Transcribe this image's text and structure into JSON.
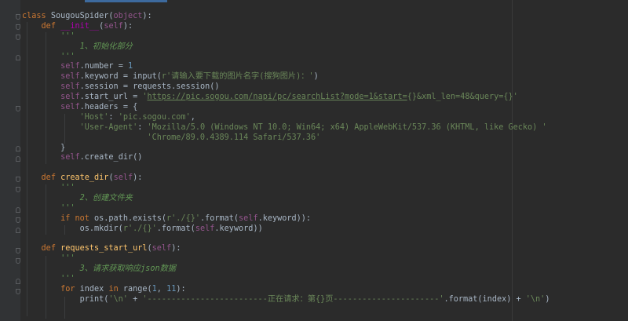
{
  "editor": {
    "lines": [
      [
        [
          "kw",
          "class "
        ],
        [
          "p",
          "SougouSpider("
        ],
        [
          "self",
          "object"
        ],
        [
          "p",
          "):"
        ]
      ],
      [
        [
          "p",
          "    "
        ],
        [
          "kw",
          "def "
        ],
        [
          "dunder",
          "__init__"
        ],
        [
          "p",
          "("
        ],
        [
          "self",
          "self"
        ],
        [
          "p",
          "):"
        ]
      ],
      [
        [
          "doc",
          "        '''"
        ]
      ],
      [
        [
          "doc",
          "            1、初始化部分"
        ]
      ],
      [
        [
          "doc",
          "        '''"
        ]
      ],
      [
        [
          "p",
          "        "
        ],
        [
          "self",
          "self"
        ],
        [
          "p",
          ".number = "
        ],
        [
          "num",
          "1"
        ]
      ],
      [
        [
          "p",
          "        "
        ],
        [
          "self",
          "self"
        ],
        [
          "p",
          ".keyword = input("
        ],
        [
          "str",
          "r'请输入要下载的图片名字(搜狗图片)：'"
        ],
        [
          "p",
          ")"
        ]
      ],
      [
        [
          "p",
          "        "
        ],
        [
          "self",
          "self"
        ],
        [
          "p",
          ".session = requests.session()"
        ]
      ],
      [
        [
          "p",
          "        "
        ],
        [
          "self",
          "self"
        ],
        [
          "p",
          ".start_url = "
        ],
        [
          "str",
          "'"
        ],
        [
          "url",
          "https://pic.sogou.com/napi/pc/searchList?mode=1&start="
        ],
        [
          "str",
          "{}&xml_len=48&query={}'"
        ]
      ],
      [
        [
          "p",
          "        "
        ],
        [
          "self",
          "self"
        ],
        [
          "p",
          ".headers = {"
        ]
      ],
      [
        [
          "p",
          "            "
        ],
        [
          "str",
          "'Host'"
        ],
        [
          "p",
          ": "
        ],
        [
          "str",
          "'pic.sogou.com'"
        ],
        [
          "p",
          ","
        ]
      ],
      [
        [
          "p",
          "            "
        ],
        [
          "str",
          "'User-Agent'"
        ],
        [
          "p",
          ": "
        ],
        [
          "str",
          "'Mozilla/5.0 (Windows NT 10.0; Win64; x64) AppleWebKit/537.36 (KHTML, like Gecko) '"
        ]
      ],
      [
        [
          "p",
          "                          "
        ],
        [
          "str",
          "'Chrome/89.0.4389.114 Safari/537.36'"
        ]
      ],
      [
        [
          "p",
          "        }"
        ]
      ],
      [
        [
          "p",
          "        "
        ],
        [
          "self",
          "self"
        ],
        [
          "p",
          ".create_dir()"
        ]
      ],
      [],
      [
        [
          "p",
          "    "
        ],
        [
          "kw",
          "def "
        ],
        [
          "fn",
          "create_dir"
        ],
        [
          "p",
          "("
        ],
        [
          "self",
          "self"
        ],
        [
          "p",
          "):"
        ]
      ],
      [
        [
          "doc",
          "        '''"
        ]
      ],
      [
        [
          "doc",
          "            2、创建文件夹"
        ]
      ],
      [
        [
          "doc",
          "        '''"
        ]
      ],
      [
        [
          "p",
          "        "
        ],
        [
          "kw",
          "if not "
        ],
        [
          "p",
          "os.path.exists("
        ],
        [
          "str",
          "r'./{}'"
        ],
        [
          "p",
          ".format("
        ],
        [
          "self",
          "self"
        ],
        [
          "p",
          ".keyword)):"
        ]
      ],
      [
        [
          "p",
          "            os.mkdir("
        ],
        [
          "str",
          "r'./{}'"
        ],
        [
          "p",
          ".format("
        ],
        [
          "self",
          "self"
        ],
        [
          "p",
          ".keyword))"
        ]
      ],
      [],
      [
        [
          "p",
          "    "
        ],
        [
          "kw",
          "def "
        ],
        [
          "fn",
          "requests_start_url"
        ],
        [
          "p",
          "("
        ],
        [
          "self",
          "self"
        ],
        [
          "p",
          "):"
        ]
      ],
      [
        [
          "doc",
          "        '''"
        ]
      ],
      [
        [
          "doc",
          "            3、请求获取响应json数据"
        ]
      ],
      [
        [
          "doc",
          "        '''"
        ]
      ],
      [
        [
          "p",
          "        "
        ],
        [
          "kw",
          "for "
        ],
        [
          "p",
          "index "
        ],
        [
          "kw",
          "in "
        ],
        [
          "p",
          "range("
        ],
        [
          "num",
          "1"
        ],
        [
          "p",
          ", "
        ],
        [
          "num",
          "11"
        ],
        [
          "p",
          "):"
        ]
      ],
      [
        [
          "p",
          "            print("
        ],
        [
          "str",
          "'\\n' "
        ],
        [
          "p",
          "+ "
        ],
        [
          "str",
          "'-------------------------正在请求：第{}页----------------------'"
        ],
        [
          "p",
          ".format(index) + "
        ],
        [
          "str",
          "'\\n'"
        ],
        [
          "p",
          ")"
        ]
      ]
    ]
  }
}
